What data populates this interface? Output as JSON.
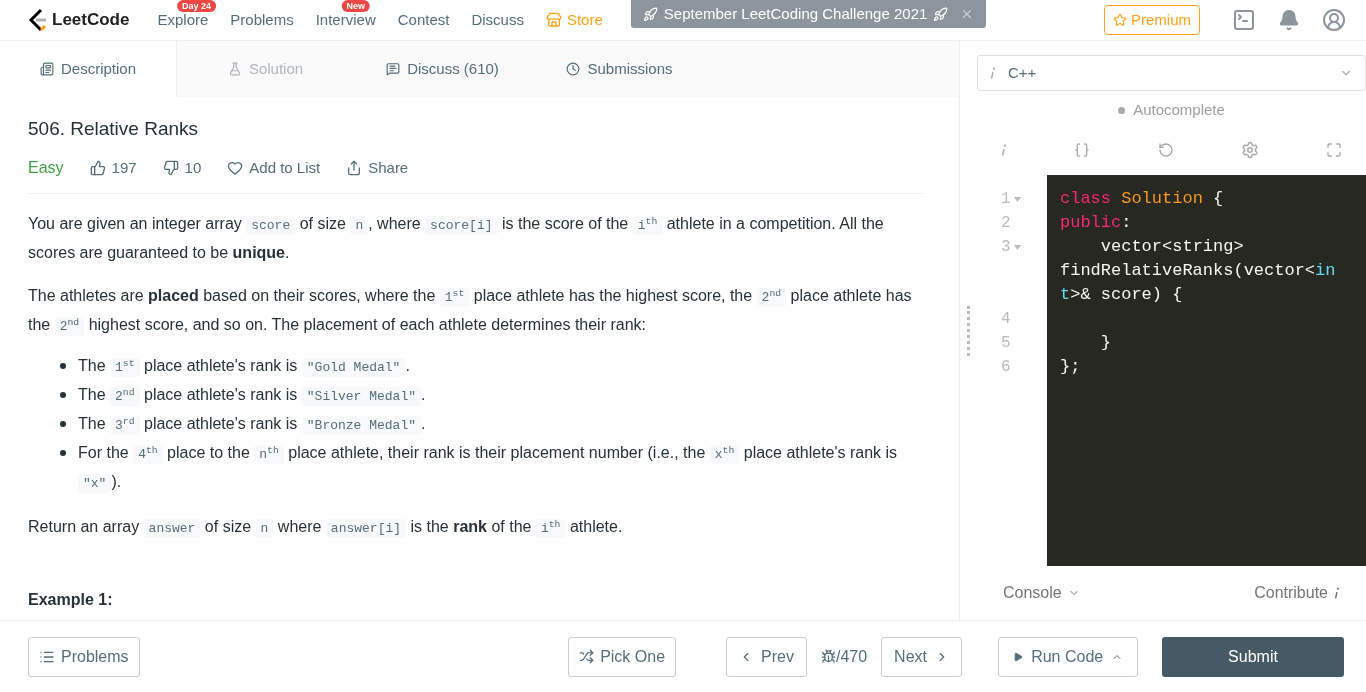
{
  "nav": {
    "logo": "LeetCode",
    "items": [
      {
        "label": "Explore",
        "badge": "Day 24",
        "kind": "link"
      },
      {
        "label": "Problems",
        "kind": "link"
      },
      {
        "label": "Interview",
        "badge": "New",
        "kind": "link"
      },
      {
        "label": "Contest",
        "kind": "link"
      },
      {
        "label": "Discuss",
        "kind": "link"
      },
      {
        "label": "Store",
        "kind": "store"
      }
    ],
    "banner": "September LeetCoding Challenge 2021",
    "premium": "Premium"
  },
  "tabs": [
    {
      "label": "Description",
      "selected": true,
      "disabled": false
    },
    {
      "label": "Solution",
      "selected": false,
      "disabled": true
    },
    {
      "label": "Discuss (610)",
      "selected": false,
      "disabled": false
    },
    {
      "label": "Submissions",
      "selected": false,
      "disabled": false
    }
  ],
  "problem": {
    "title": "506. Relative Ranks",
    "difficulty": "Easy",
    "likes": "197",
    "dislikes": "10",
    "add_to_list": "Add to List",
    "share": "Share",
    "paragraphs": [
      [
        {
          "kind": "text",
          "text": "You are given an integer array "
        },
        {
          "kind": "code",
          "text": "score"
        },
        {
          "kind": "text",
          "text": " of size "
        },
        {
          "kind": "code",
          "text": "n"
        },
        {
          "kind": "text",
          "text": ", where "
        },
        {
          "kind": "code",
          "text": "score[i]"
        },
        {
          "kind": "text",
          "text": " is the score of the "
        },
        {
          "kind": "code",
          "text": "i",
          "sup": "th"
        },
        {
          "kind": "text",
          "text": " athlete in a competition. All the scores are guaranteed to be "
        },
        {
          "kind": "bold",
          "text": "unique"
        },
        {
          "kind": "text",
          "text": "."
        }
      ],
      [
        {
          "kind": "text",
          "text": "The athletes are "
        },
        {
          "kind": "bold",
          "text": "placed"
        },
        {
          "kind": "text",
          "text": " based on their scores, where the "
        },
        {
          "kind": "code",
          "text": "1",
          "sup": "st"
        },
        {
          "kind": "text",
          "text": " place athlete has the highest score, the "
        },
        {
          "kind": "code",
          "text": "2",
          "sup": "nd"
        },
        {
          "kind": "text",
          "text": " place athlete has the "
        },
        {
          "kind": "code",
          "text": "2",
          "sup": "nd"
        },
        {
          "kind": "text",
          "text": " highest score, and so on. The placement of each athlete determines their rank:"
        }
      ]
    ],
    "bullets": [
      [
        {
          "kind": "text",
          "text": "The "
        },
        {
          "kind": "code",
          "text": "1",
          "sup": "st"
        },
        {
          "kind": "text",
          "text": " place athlete's rank is "
        },
        {
          "kind": "code",
          "text": "\"Gold Medal\""
        },
        {
          "kind": "text",
          "text": "."
        }
      ],
      [
        {
          "kind": "text",
          "text": "The "
        },
        {
          "kind": "code",
          "text": "2",
          "sup": "nd"
        },
        {
          "kind": "text",
          "text": " place athlete's rank is "
        },
        {
          "kind": "code",
          "text": "\"Silver Medal\""
        },
        {
          "kind": "text",
          "text": "."
        }
      ],
      [
        {
          "kind": "text",
          "text": "The "
        },
        {
          "kind": "code",
          "text": "3",
          "sup": "rd"
        },
        {
          "kind": "text",
          "text": " place athlete's rank is "
        },
        {
          "kind": "code",
          "text": "\"Bronze Medal\""
        },
        {
          "kind": "text",
          "text": "."
        }
      ],
      [
        {
          "kind": "text",
          "text": "For the "
        },
        {
          "kind": "code",
          "text": "4",
          "sup": "th"
        },
        {
          "kind": "text",
          "text": " place to the "
        },
        {
          "kind": "code",
          "text": "n",
          "sup": "th"
        },
        {
          "kind": "text",
          "text": " place athlete, their rank is their placement number (i.e., the "
        },
        {
          "kind": "code",
          "text": "x",
          "sup": "th"
        },
        {
          "kind": "text",
          "text": " place athlete's rank is "
        },
        {
          "kind": "code",
          "text": "\"x\""
        },
        {
          "kind": "text",
          "text": ")."
        }
      ]
    ],
    "closing": [
      {
        "kind": "text",
        "text": "Return an array "
      },
      {
        "kind": "code",
        "text": "answer"
      },
      {
        "kind": "text",
        "text": " of size "
      },
      {
        "kind": "code",
        "text": "n"
      },
      {
        "kind": "text",
        "text": " where "
      },
      {
        "kind": "code",
        "text": "answer[i]"
      },
      {
        "kind": "text",
        "text": " is the "
      },
      {
        "kind": "bold",
        "text": "rank"
      },
      {
        "kind": "text",
        "text": " of the "
      },
      {
        "kind": "code",
        "text": "i",
        "sup": "th"
      },
      {
        "kind": "text",
        "text": " athlete."
      }
    ],
    "example_heading": "Example 1:"
  },
  "editor": {
    "language": "C++",
    "autocomplete": {
      "label": "Autocomplete",
      "on": false
    },
    "lines": [
      {
        "number": "1",
        "foldable": true,
        "tokens": [
          {
            "kind": "keyword",
            "text": "class"
          },
          {
            "kind": "type",
            "text": "Solution"
          },
          {
            "kind": "plain",
            "text": "{"
          }
        ]
      },
      {
        "number": "2",
        "foldable": false,
        "tokens": [
          {
            "kind": "keyword",
            "text": "public"
          },
          {
            "kind": "plain",
            "text": ":"
          }
        ]
      },
      {
        "number": "3",
        "foldable": true,
        "tokens": [
          {
            "kind": "plain",
            "text": "    vector<string> findRelativeRanks(vector<"
          },
          {
            "kind": "builtin",
            "text": "int"
          },
          {
            "kind": "plain",
            "text": ">& score) {"
          }
        ]
      },
      {
        "number": "4",
        "foldable": false
      },
      {
        "number": "5",
        "foldable": false,
        "tokens": [
          {
            "kind": "plain",
            "text": "    }"
          }
        ]
      },
      {
        "number": "6",
        "foldable": false,
        "tokens": [
          {
            "kind": "plain",
            "text": "};"
          }
        ]
      }
    ],
    "console": "Console",
    "contribute": "Contribute"
  },
  "footer": {
    "problems": "Problems",
    "pick_one": "Pick One",
    "prev": "Prev",
    "counter": "/470",
    "next": "Next",
    "run_code": "Run Code",
    "submit": "Submit"
  }
}
